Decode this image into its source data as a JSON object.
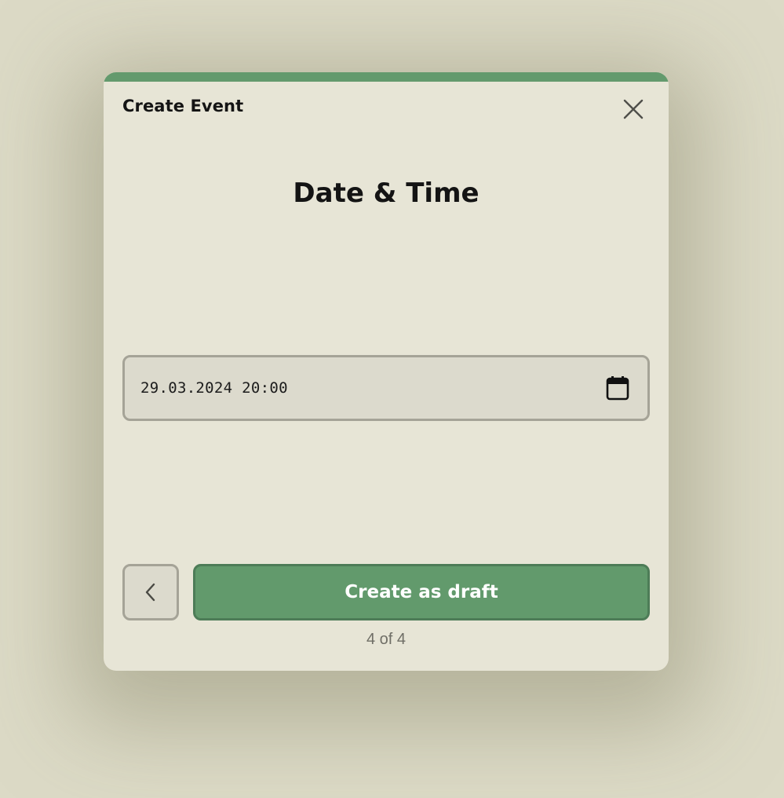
{
  "modal": {
    "title": "Create Event",
    "close_icon": "close-icon",
    "accent_color": "#639a6d"
  },
  "step": {
    "heading": "Date & Time",
    "counter": "4 of 4"
  },
  "datetime": {
    "value": "29.03.2024 20:00",
    "icon": "calendar-icon"
  },
  "actions": {
    "back_icon": "chevron-left-icon",
    "primary_label": "Create as draft",
    "primary_color": "#629a6c"
  }
}
